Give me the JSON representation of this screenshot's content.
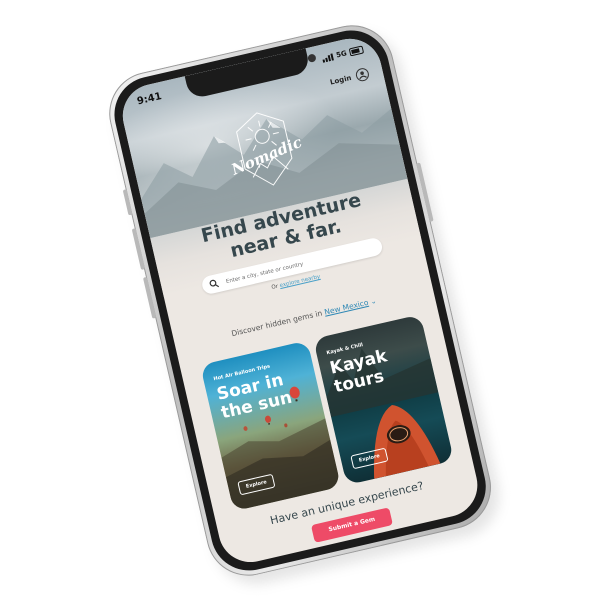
{
  "status": {
    "time": "9:41",
    "network": "5G"
  },
  "header": {
    "login_label": "Login",
    "logo_text": "Nomadic"
  },
  "hero": {
    "headline_line1": "Find adventure",
    "headline_line2": "near & far."
  },
  "search": {
    "placeholder": "Enter a city, state or country",
    "nearby_prefix": "Or",
    "nearby_link": "explore nearby"
  },
  "discover": {
    "prefix": "Discover hidden gems in",
    "location": "New Mexico"
  },
  "cards": [
    {
      "subtitle": "Hot Air Balloon Trips",
      "title": "Soar in the sun",
      "button": "Explore"
    },
    {
      "subtitle": "Kayak & Chill",
      "title": "Kayak tours",
      "button": "Explore"
    }
  ],
  "cta": {
    "question": "Have an unique experience?",
    "button": "Submit a Gem"
  },
  "colors": {
    "accent": "#ee4b67",
    "link": "#2f88b5",
    "headline": "#36474d",
    "screen_bg": "#ede8e3"
  }
}
